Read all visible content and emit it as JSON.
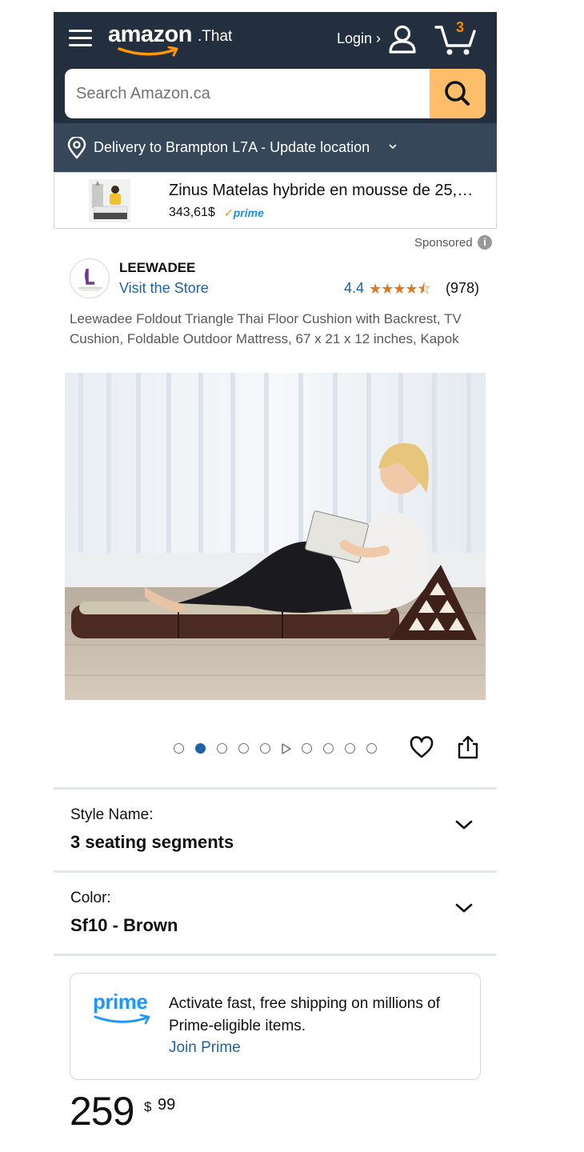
{
  "header": {
    "logo_text": "amazon",
    "logo_suffix": ".That",
    "login_label": "Login ›",
    "cart_count": "3"
  },
  "search": {
    "placeholder": "Search Amazon.ca"
  },
  "delivery": {
    "text": "Delivery to Brampton L7A - Update location"
  },
  "sponsored_banner": {
    "title": "Zinus Matelas hybride en mousse de 25,…",
    "price": "343,61$",
    "prime_badge": "prime"
  },
  "sponsored_label": "Sponsored",
  "store": {
    "brand": "LEEWADEE",
    "visit_label": "Visit the Store",
    "rating": "4.4",
    "stars": "★★★★⯪",
    "review_count": "(978)"
  },
  "product": {
    "title": "Leewadee Foldout Triangle Thai Floor Cushion with Backrest, TV Cushion, Foldable Outdoor Mattress, 67 x 21 x 12 inches, Kapok",
    "image_count": 10,
    "active_image_index": 1
  },
  "options": [
    {
      "label": "Style Name:",
      "value": "3 seating segments"
    },
    {
      "label": "Color:",
      "value": "Sf10 - Brown"
    }
  ],
  "prime": {
    "logo_text": "prime",
    "message": "Activate fast, free shipping on millions of Prime-eligible items.",
    "join_label": "Join Prime"
  },
  "price": {
    "whole": "259",
    "symbol": "$",
    "cents": "99"
  },
  "colors": {
    "header_bg": "#232f3e",
    "delivery_bg": "#37475a",
    "search_button": "#febd69",
    "link_blue": "#2162a1",
    "star_orange": "#de7921",
    "prime_blue": "#1a98ff"
  }
}
